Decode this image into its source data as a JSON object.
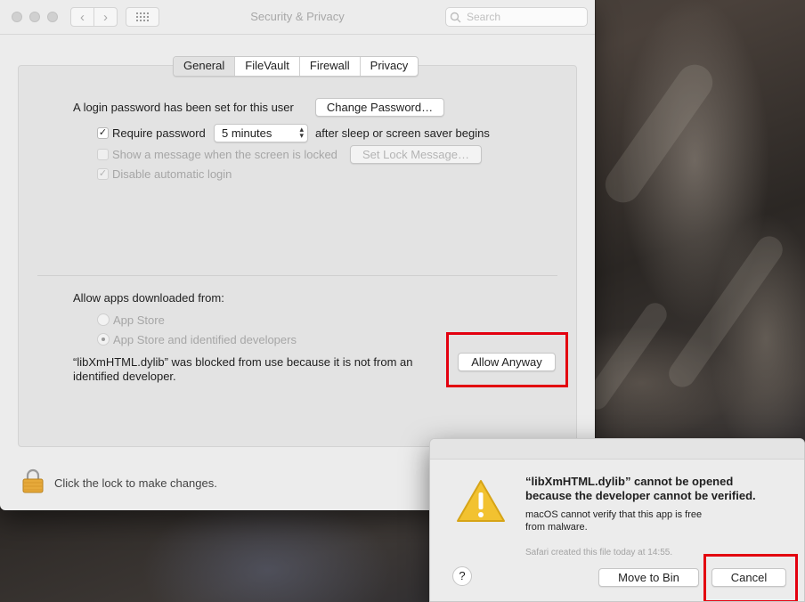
{
  "window": {
    "title": "Security & Privacy",
    "search_placeholder": "Search"
  },
  "tabs": [
    "General",
    "FileVault",
    "Firewall",
    "Privacy"
  ],
  "general": {
    "login_password_text": "A login password has been set for this user",
    "change_password_button": "Change Password…",
    "require_password_label": "Require password",
    "require_password_checked": true,
    "require_password_value": "5 minutes",
    "after_sleep_text": "after sleep or screen saver begins",
    "show_message_label": "Show a message when the screen is locked",
    "set_lock_message_button": "Set Lock Message…",
    "disable_auto_login_label": "Disable automatic login",
    "allow_apps_heading": "Allow apps downloaded from:",
    "app_store_option": "App Store",
    "app_store_identified_option": "App Store and identified developers",
    "blocked_line1": "“libXmHTML.dylib” was blocked from use because it is not from an",
    "blocked_line2": "identified developer.",
    "allow_anyway_button": "Allow Anyway"
  },
  "footer": {
    "lock_text": "Click the lock to make changes."
  },
  "alert": {
    "title_line1": "“libXmHTML.dylib” cannot be opened",
    "title_line2": "because the developer cannot be verified.",
    "body_line1": "macOS cannot verify that this app is free",
    "body_line2": "from malware.",
    "source_text": "Safari created this file today at 14:55.",
    "help_label": "?",
    "move_to_bin_button": "Move to Bin",
    "cancel_button": "Cancel"
  },
  "colors": {
    "highlight_box": "#e3000f",
    "warning_icon": "#f2c230"
  }
}
